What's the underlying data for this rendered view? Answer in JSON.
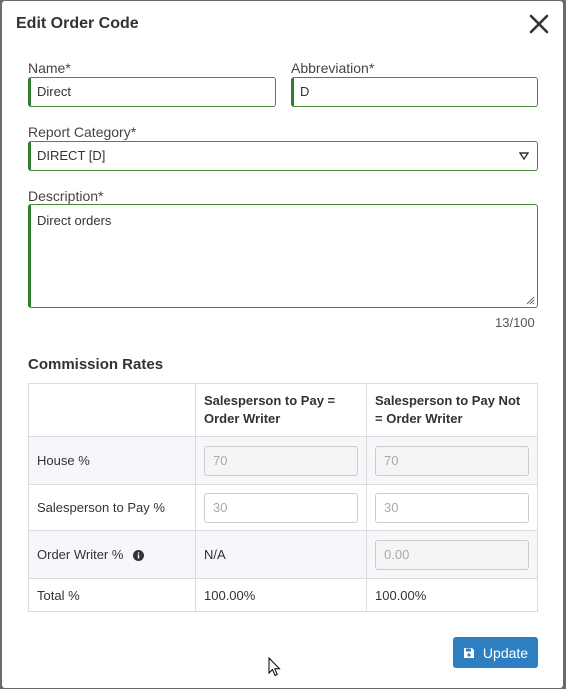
{
  "dialog": {
    "title": "Edit Order Code",
    "close_icon": "close-icon"
  },
  "form": {
    "name": {
      "label": "Name*",
      "value": "Direct"
    },
    "abbreviation": {
      "label": "Abbreviation*",
      "value": "D"
    },
    "report_category": {
      "label": "Report Category*",
      "value": "DIRECT [D]"
    },
    "description": {
      "label": "Description*",
      "value": "Direct orders",
      "char_count": "13/100"
    }
  },
  "commission": {
    "title": "Commission Rates",
    "columns": [
      "",
      "Salesperson to Pay = Order Writer",
      "Salesperson to Pay Not = Order Writer"
    ],
    "rows": [
      {
        "label": "House %",
        "equal": "70",
        "not_equal": "70"
      },
      {
        "label": "Salesperson to Pay %",
        "equal": "30",
        "not_equal": "30"
      },
      {
        "label": "Order Writer %",
        "equal": "N/A",
        "not_equal": "0.00"
      },
      {
        "label": "Total %",
        "equal": "100.00%",
        "not_equal": "100.00%"
      }
    ]
  },
  "actions": {
    "update_label": "Update"
  },
  "colors": {
    "accent": "#2d7fc1",
    "valid_border": "#2f7d2f"
  }
}
